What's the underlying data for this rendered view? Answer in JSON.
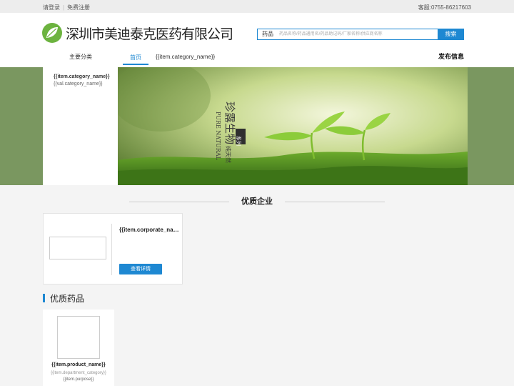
{
  "topbar": {
    "login": "请登录",
    "register": "免费注册",
    "service": "客服:0755-86217603"
  },
  "header": {
    "company_name": "深圳市美迪泰克医药有限公司",
    "search": {
      "type_label": "药品",
      "placeholder": "药品名称/药品通用名/药品助记码/厂家名称/供应商名称",
      "button": "搜索"
    }
  },
  "nav": {
    "category_label": "主要分类",
    "tabs": [
      {
        "label": "首页",
        "active": true
      },
      {
        "label": "{{item.category_name}}",
        "active": false
      }
    ],
    "publish": "发布信息"
  },
  "sidebar": {
    "item_category": "{{item.category_name}}",
    "val_category": "{{val.category_name}}"
  },
  "banner": {
    "title_vertical": "珍露生物",
    "series": "系列",
    "english": "PURE NATURAL",
    "pure": "纯天然"
  },
  "sections": {
    "corporate_title": "优质企业",
    "drugs_title": "优质药品"
  },
  "corporate": {
    "name": "{{item.corporate_name}}",
    "detail_button": "查看详情"
  },
  "product": {
    "name": "{{item.product_name}}",
    "department": "{{item.department_category}}",
    "purpose": "{{item.purpose}}"
  },
  "colors": {
    "accent": "#1e88d2",
    "banner_bg": "#7a9760"
  }
}
